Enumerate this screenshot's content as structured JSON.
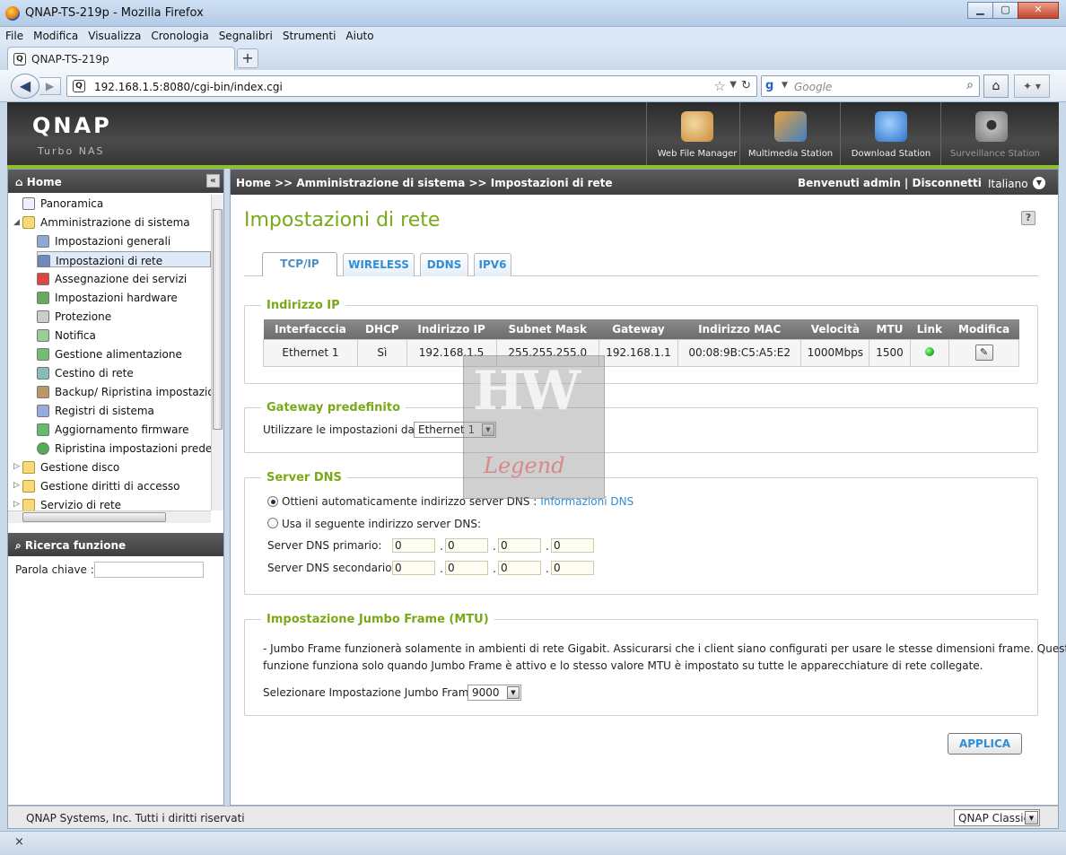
{
  "browser": {
    "window_title": "QNAP-TS-219p - Mozilla Firefox",
    "menu": [
      "File",
      "Modifica",
      "Visualizza",
      "Cronologia",
      "Segnalibri",
      "Strumenti",
      "Aiuto"
    ],
    "tab_title": "QNAP-TS-219p",
    "tab_icon_letter": "Q",
    "url": "192.168.1.5:8080/cgi-bin/index.cgi",
    "search_placeholder": "Google",
    "search_engine_letter": "g",
    "status_close": "×"
  },
  "header": {
    "logo": "QNAP",
    "subtitle": "Turbo NAS",
    "apps": [
      {
        "label": "Web File Manager",
        "icon": "web-file-manager-icon",
        "color": "#c98a3a"
      },
      {
        "label": "Multimedia Station",
        "icon": "multimedia-station-icon",
        "color": "#3f7fc4"
      },
      {
        "label": "Download Station",
        "icon": "download-station-icon",
        "color": "#2f73c9"
      },
      {
        "label": "Surveillance Station",
        "icon": "surveillance-station-icon",
        "color": "#9a9a9a"
      }
    ]
  },
  "sidebar": {
    "home_label": "Home",
    "collapse_glyph": "«",
    "items": [
      {
        "label": "Panoramica",
        "icon": "overview-icon",
        "indent": 0
      },
      {
        "label": "Amministrazione di sistema",
        "icon": "folder-open-icon",
        "indent": 0,
        "expanded": true
      },
      {
        "label": "Impostazioni generali",
        "icon": "general-settings-icon",
        "indent": 1
      },
      {
        "label": "Impostazioni di rete",
        "icon": "network-settings-icon",
        "indent": 1,
        "selected": true
      },
      {
        "label": "Assegnazione dei servizi",
        "icon": "service-binding-icon",
        "indent": 1
      },
      {
        "label": "Impostazioni hardware",
        "icon": "hardware-icon",
        "indent": 1
      },
      {
        "label": "Protezione",
        "icon": "security-icon",
        "indent": 1
      },
      {
        "label": "Notifica",
        "icon": "notification-icon",
        "indent": 1
      },
      {
        "label": "Gestione alimentazione",
        "icon": "power-icon",
        "indent": 1
      },
      {
        "label": "Cestino di rete",
        "icon": "recycle-bin-icon",
        "indent": 1
      },
      {
        "label": "Backup/ Ripristina impostazion",
        "icon": "backup-icon",
        "indent": 1
      },
      {
        "label": "Registri di sistema",
        "icon": "system-logs-icon",
        "indent": 1
      },
      {
        "label": "Aggiornamento firmware",
        "icon": "firmware-icon",
        "indent": 1
      },
      {
        "label": "Ripristina impostazioni predefir",
        "icon": "restore-icon",
        "indent": 1
      },
      {
        "label": "Gestione disco",
        "icon": "folder-icon",
        "indent": 0
      },
      {
        "label": "Gestione diritti di accesso",
        "icon": "folder-icon",
        "indent": 0
      },
      {
        "label": "Servizio di rete",
        "icon": "folder-icon",
        "indent": 0
      }
    ],
    "search_title": "Ricerca funzione",
    "keyword_label": "Parola chiave :"
  },
  "main": {
    "breadcrumb": "Home >> Amministrazione di sistema >> Impostazioni di rete",
    "welcome": "Benvenuti admin",
    "logout": "Disconnetti",
    "language": "Italiano",
    "page_title": "Impostazioni di rete",
    "help_glyph": "?",
    "tabs": [
      "TCP/IP",
      "WIRELESS",
      "DDNS",
      "IPV6"
    ],
    "ip_section": {
      "legend": "Indirizzo IP",
      "columns": [
        "Interfacccia",
        "DHCP",
        "Indirizzo IP",
        "Subnet Mask",
        "Gateway",
        "Indirizzo MAC",
        "Velocità",
        "MTU",
        "Link",
        "Modifica"
      ],
      "rows": [
        {
          "interface": "Ethernet 1",
          "dhcp": "Sì",
          "ip": "192.168.1.5",
          "mask": "255.255.255.0",
          "gateway": "192.168.1.1",
          "mac": "00:08:9B:C5:A5:E2",
          "speed": "1000Mbps",
          "mtu": "1500",
          "link_color": "#22bb22",
          "edit_glyph": "✎"
        }
      ]
    },
    "gateway_section": {
      "legend": "Gateway predefinito",
      "label": "Utilizzare le impostazioni da:",
      "value": "Ethernet 1"
    },
    "dns_section": {
      "legend": "Server DNS",
      "auto_label": "Ottieni automaticamente indirizzo server DNS :",
      "auto_link": "Informazioni DNS",
      "manual_label": "Usa il seguente indirizzo server DNS:",
      "primary_label": "Server DNS primario:",
      "secondary_label": "Server DNS secondario:",
      "primary": [
        "0",
        "0",
        "0",
        "0"
      ],
      "secondary": [
        "0",
        "0",
        "0",
        "0"
      ]
    },
    "jumbo_section": {
      "legend": "Impostazione Jumbo Frame (MTU)",
      "note1": "- Jumbo Frame funzionerà solamente in ambienti di rete Gigabit. Assicurarsi che i client siano configurati per usare le stesse dimensioni frame. Questa",
      "note2": "funzione funziona solo quando Jumbo Frame è attivo e lo stesso valore MTU è impostato su tutte le apparecchiature di rete collegate.",
      "select_label": "Selezionare Impostazione Jumbo Frame:",
      "value": "9000"
    },
    "apply": "APPLICA"
  },
  "footer": {
    "copyright": "QNAP Systems, Inc. Tutti i diritti riservati",
    "style": "QNAP Classic"
  },
  "watermark": {
    "top": "HW",
    "bottom": "Legend"
  }
}
